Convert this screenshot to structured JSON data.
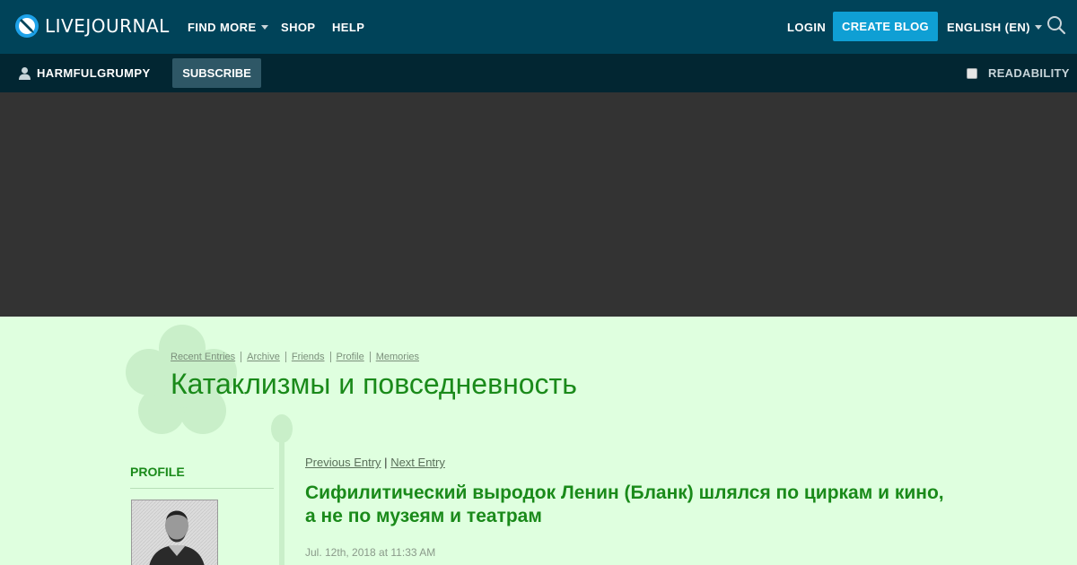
{
  "topbar": {
    "logo_text": "LIVEJOURNAL",
    "find_more": "FIND MORE",
    "shop": "SHOP",
    "help": "HELP",
    "login": "LOGIN",
    "create_blog": "CREATE BLOG",
    "language": "ENGLISH (EN)"
  },
  "userbar": {
    "username": "HARMFULGRUMPY",
    "subscribe": "SUBSCRIBE",
    "readability": "READABILITY"
  },
  "journal": {
    "nav": [
      "Recent Entries",
      "Archive",
      "Friends",
      "Profile",
      "Memories"
    ],
    "title": "Катаклизмы и повседневность"
  },
  "sidebar": {
    "heading": "PROFILE"
  },
  "entry": {
    "previous": "Previous Entry",
    "separator": "|",
    "next": "Next Entry",
    "title": "Сифилитический выродок Ленин (Бланк) шлялся по циркам и кино, а не по музеям и театрам",
    "date": "Jul. 12th, 2018 at 11:33 AM"
  },
  "colors": {
    "topbar": "#004359",
    "userbar": "#022632",
    "accent_button": "#0f9fd4",
    "page_background": "#dfffdf",
    "title_green": "#1a8a1a"
  },
  "icons": [
    "livejournal-logo-icon",
    "search-icon",
    "user-icon",
    "chevron-down-icon",
    "flower-icon"
  ]
}
